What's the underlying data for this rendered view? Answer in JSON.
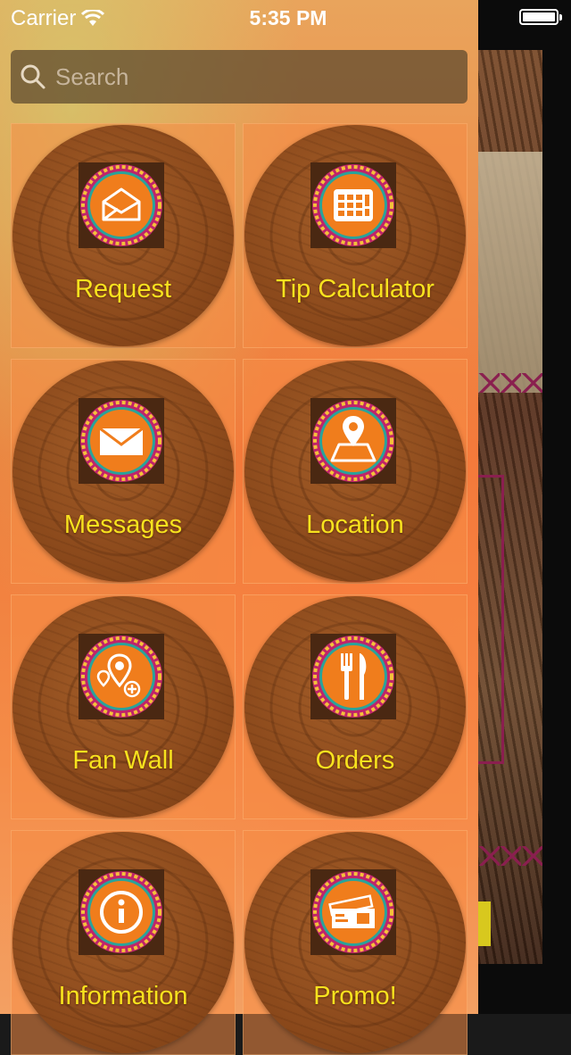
{
  "status_bar": {
    "carrier": "Carrier",
    "time": "5:35 PM"
  },
  "search": {
    "placeholder": "Search"
  },
  "menu": {
    "items": [
      {
        "label": "Request",
        "icon": "envelope-open-icon"
      },
      {
        "label": "Tip Calculator",
        "icon": "calculator-icon"
      },
      {
        "label": "Messages",
        "icon": "envelope-icon"
      },
      {
        "label": "Location",
        "icon": "map-pin-icon"
      },
      {
        "label": "Fan Wall",
        "icon": "fan-wall-pins-icon"
      },
      {
        "label": "Orders",
        "icon": "fork-knife-icon"
      },
      {
        "label": "Information",
        "icon": "info-icon"
      },
      {
        "label": "Promo!",
        "icon": "ticket-icon"
      }
    ]
  },
  "colors": {
    "label": "#f7e21e",
    "badge_orange": "#f07d1c",
    "badge_ring": "#c0246a"
  }
}
